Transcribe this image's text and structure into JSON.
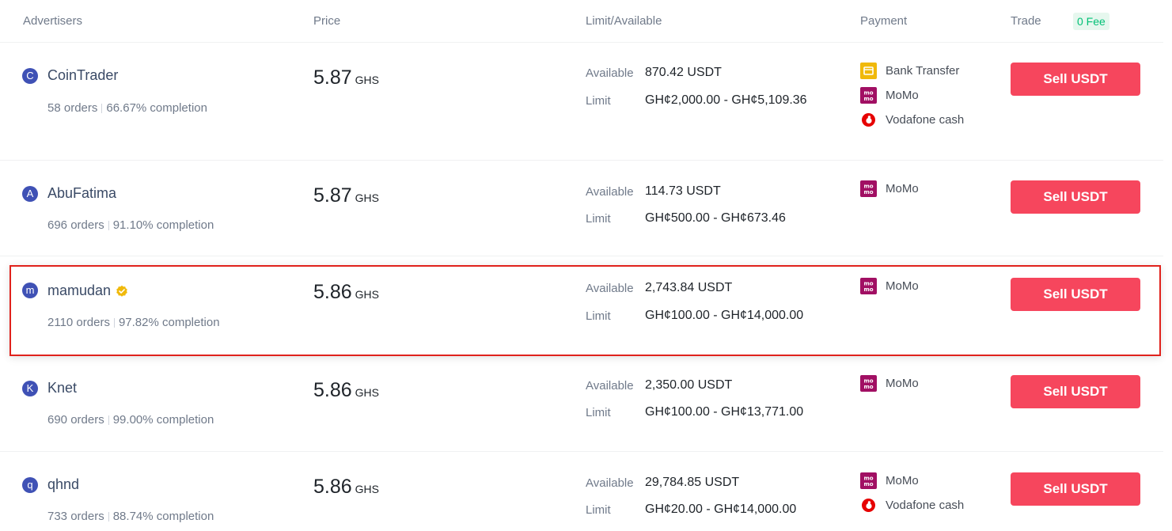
{
  "header": {
    "advertisers": "Advertisers",
    "price": "Price",
    "limit_available": "Limit/Available",
    "payment": "Payment",
    "trade": "Trade",
    "fee_badge": "0 Fee"
  },
  "labels": {
    "available": "Available",
    "limit": "Limit",
    "currency": "GHS",
    "sell_button": "Sell USDT"
  },
  "colors": {
    "accent_sell": "#f6465d",
    "fee_green": "#02c076",
    "highlight_border": "#e0221c",
    "avatar_blue": "#3f51b5"
  },
  "payment_methods": {
    "bank": {
      "label": "Bank Transfer",
      "icon": "bank-card-icon"
    },
    "momo": {
      "label": "MoMo",
      "icon": "momo-icon"
    },
    "vodafone": {
      "label": "Vodafone cash",
      "icon": "vodafone-icon"
    }
  },
  "advertisers": [
    {
      "initial": "C",
      "name": "CoinTrader",
      "verified": false,
      "orders": "58 orders",
      "completion": "66.67% completion",
      "price": "5.87",
      "available": "870.42 USDT",
      "limit": "GH¢2,000.00 - GH¢5,109.36",
      "payments": [
        "Bank Transfer",
        "MoMo",
        "Vodafone cash"
      ]
    },
    {
      "initial": "A",
      "name": "AbuFatima",
      "verified": false,
      "orders": "696 orders",
      "completion": "91.10% completion",
      "price": "5.87",
      "available": "114.73 USDT",
      "limit": "GH¢500.00 - GH¢673.46",
      "payments": [
        "MoMo"
      ]
    },
    {
      "initial": "m",
      "name": "mamudan",
      "verified": true,
      "orders": "2110 orders",
      "completion": "97.82% completion",
      "price": "5.86",
      "available": "2,743.84 USDT",
      "limit": "GH¢100.00 - GH¢14,000.00",
      "payments": [
        "MoMo"
      ]
    },
    {
      "initial": "K",
      "name": "Knet",
      "verified": false,
      "orders": "690 orders",
      "completion": "99.00% completion",
      "price": "5.86",
      "available": "2,350.00 USDT",
      "limit": "GH¢100.00 - GH¢13,771.00",
      "payments": [
        "MoMo"
      ]
    },
    {
      "initial": "q",
      "name": "qhnd",
      "verified": false,
      "orders": "733 orders",
      "completion": "88.74% completion",
      "price": "5.86",
      "available": "29,784.85 USDT",
      "limit": "GH¢20.00 - GH¢14,000.00",
      "payments": [
        "MoMo",
        "Vodafone cash"
      ]
    }
  ]
}
